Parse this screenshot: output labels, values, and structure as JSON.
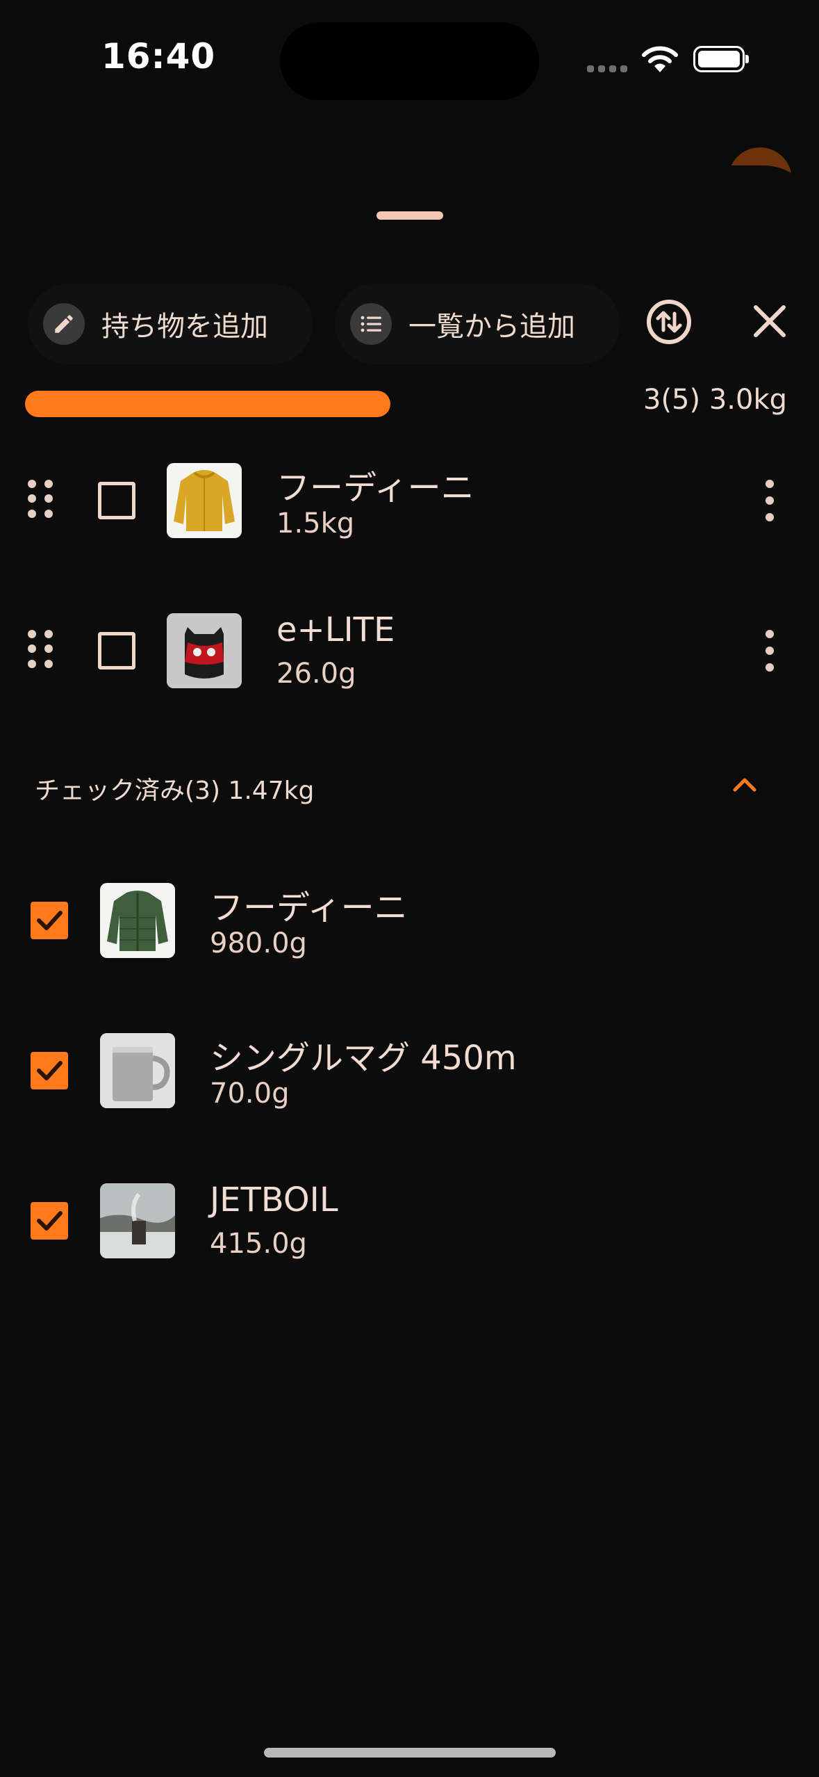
{
  "status_bar": {
    "time": "16:40"
  },
  "toolbar": {
    "add_item_label": "持ち物を追加",
    "add_from_list_label": "一覧から追加"
  },
  "progress": {
    "fraction": 0.49,
    "summary": "3(5) 3.0kg",
    "color": "#ff7a1a"
  },
  "unchecked_items": [
    {
      "name": "フーディーニ",
      "weight": "1.5kg",
      "image": "yellow-jacket"
    },
    {
      "name": "e+LITE",
      "weight": "26.0g",
      "image": "red-lantern"
    }
  ],
  "checked_section": {
    "header": "チェック済み(3) 1.47kg",
    "items": [
      {
        "name": "フーディーニ",
        "weight": "980.0g",
        "image": "green-jacket"
      },
      {
        "name": "シングルマグ 450m",
        "weight": "70.0g",
        "image": "titanium-mug"
      },
      {
        "name": "JETBOIL",
        "weight": "415.0g",
        "image": "jetboil-photo"
      }
    ]
  },
  "colors": {
    "accent": "#ff7a1a",
    "background": "#0b0b0b",
    "text": "#f2ddd2"
  }
}
